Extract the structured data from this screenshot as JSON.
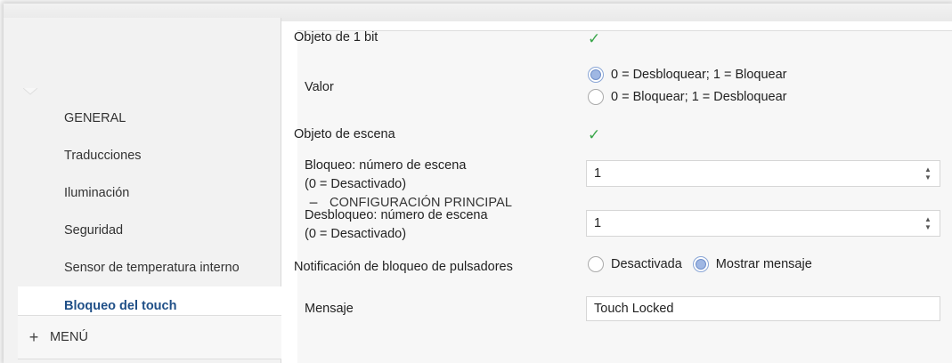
{
  "sidebar": {
    "main_section": {
      "sign": "−",
      "label": "CONFIGURACIÓN PRINCIPAL"
    },
    "items": [
      {
        "label": "GENERAL"
      },
      {
        "label": "Traducciones"
      },
      {
        "label": "Iluminación"
      },
      {
        "label": "Seguridad"
      },
      {
        "label": "Sensor de temperatura interno"
      },
      {
        "label": "Bloqueo del touch"
      }
    ],
    "menu_section": {
      "sign": "+",
      "label": "MENÚ"
    }
  },
  "form": {
    "obj_1bit": {
      "label": "Objeto de 1 bit",
      "checked": true,
      "check_glyph": "✓"
    },
    "valor": {
      "label": "Valor",
      "options": [
        "0 = Desbloquear; 1 = Bloquear",
        "0 = Bloquear; 1 = Desbloquear"
      ],
      "selected_index": 0
    },
    "obj_escena": {
      "label": "Objeto de escena",
      "checked": true,
      "check_glyph": "✓"
    },
    "bloqueo": {
      "label_line1": "Bloqueo: número de escena",
      "label_line2": "(0 = Desactivado)",
      "value": "1"
    },
    "desbloqueo": {
      "label_line1": "Desbloqueo: número de escena",
      "label_line2": "(0 = Desactivado)",
      "value": "1"
    },
    "notificacion": {
      "label": "Notificación de bloqueo de pulsadores",
      "options": [
        "Desactivada",
        "Mostrar mensaje"
      ],
      "selected_index": 1
    },
    "mensaje": {
      "label": "Mensaje",
      "value": "Touch Locked"
    }
  },
  "spinner_glyphs": {
    "up": "▲",
    "down": "▼"
  },
  "colors": {
    "active_item": "#1f4f87",
    "check": "#3aa64a",
    "radio_selected": "#9fb7e3"
  }
}
